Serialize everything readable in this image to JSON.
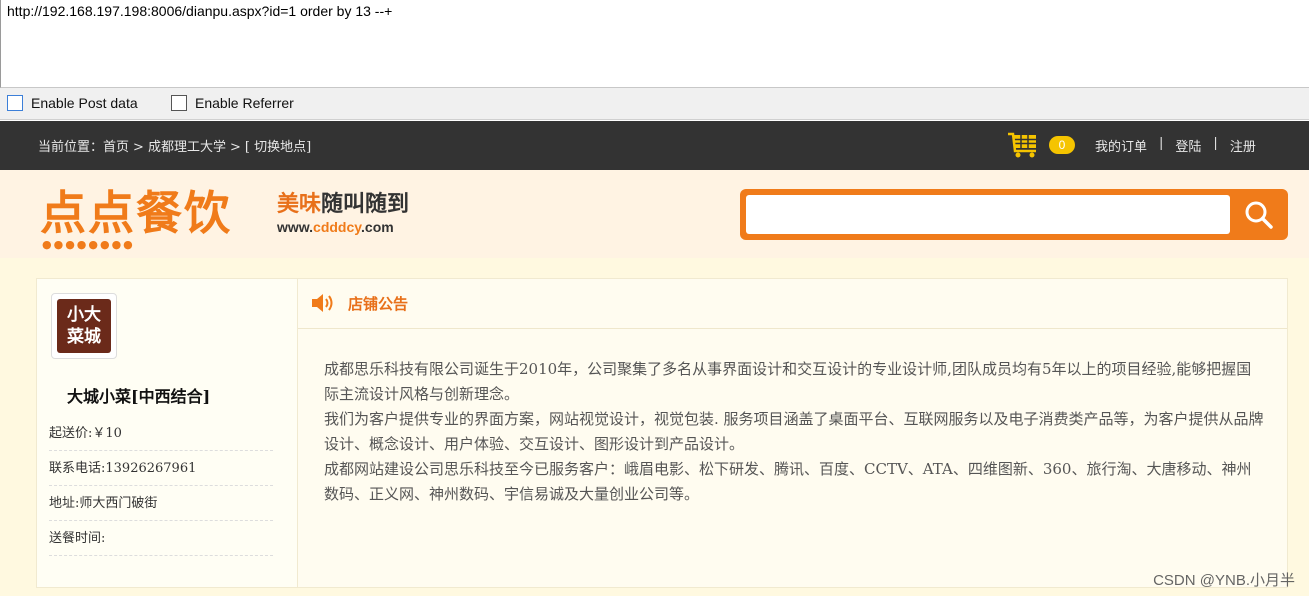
{
  "url_bar": {
    "value": "http://192.168.197.198:8006/dianpu.aspx?id=1 order by 13 --+"
  },
  "options": {
    "post_data": "Enable Post data",
    "referrer": "Enable Referrer"
  },
  "topbar": {
    "crumb_label": "当前位置：",
    "crumb_home": "首页",
    "crumb_sep1": ">",
    "crumb_school": "成都理工大学",
    "crumb_sep2": ">",
    "crumb_switch": "[ 切换地点]",
    "cart_count": "0",
    "my_orders": "我的订单",
    "sep": "|",
    "login": "登陆",
    "register": "注册"
  },
  "header": {
    "logo_text": "点点餐饮",
    "slogan_a": "美味",
    "slogan_b": "随叫随到",
    "site_a": "www.",
    "site_b": "cdddcy",
    "site_c": ".com",
    "search_placeholder": ""
  },
  "shop": {
    "logo_text_1": "小大",
    "logo_text_2": "菜城",
    "name": "大城小菜[中西结合]",
    "min_price": "起送价:￥10",
    "phone": "联系电话:13926267961",
    "address": "地址:师大西门破街",
    "delivery_time": "送餐时间:"
  },
  "notice": {
    "title": "店铺公告",
    "para1": "成都思乐科技有限公司诞生于2010年，公司聚集了多名从事界面设计和交互设计的专业设计师,团队成员均有5年以上的项目经验,能够把握国际主流设计风格与创新理念。",
    "para2": "我们为客户提供专业的界面方案，网站视觉设计，视觉包装. 服务项目涵盖了桌面平台、互联网服务以及电子消费类产品等，为客户提供从品牌设计、概念设计、用户体验、交互设计、图形设计到产品设计。",
    "para3": "成都网站建设公司思乐科技至今已服务客户：峨眉电影、松下研发、腾讯、百度、CCTV、ATA、四维图新、360、旅行淘、大唐移动、神州数码、正义网、神州数码、宇信易诚及大量创业公司等。"
  },
  "watermark": "CSDN @YNB.小月半",
  "colors": {
    "accent": "#f07b1a",
    "topbar": "#333333",
    "badge": "#f5c400"
  }
}
